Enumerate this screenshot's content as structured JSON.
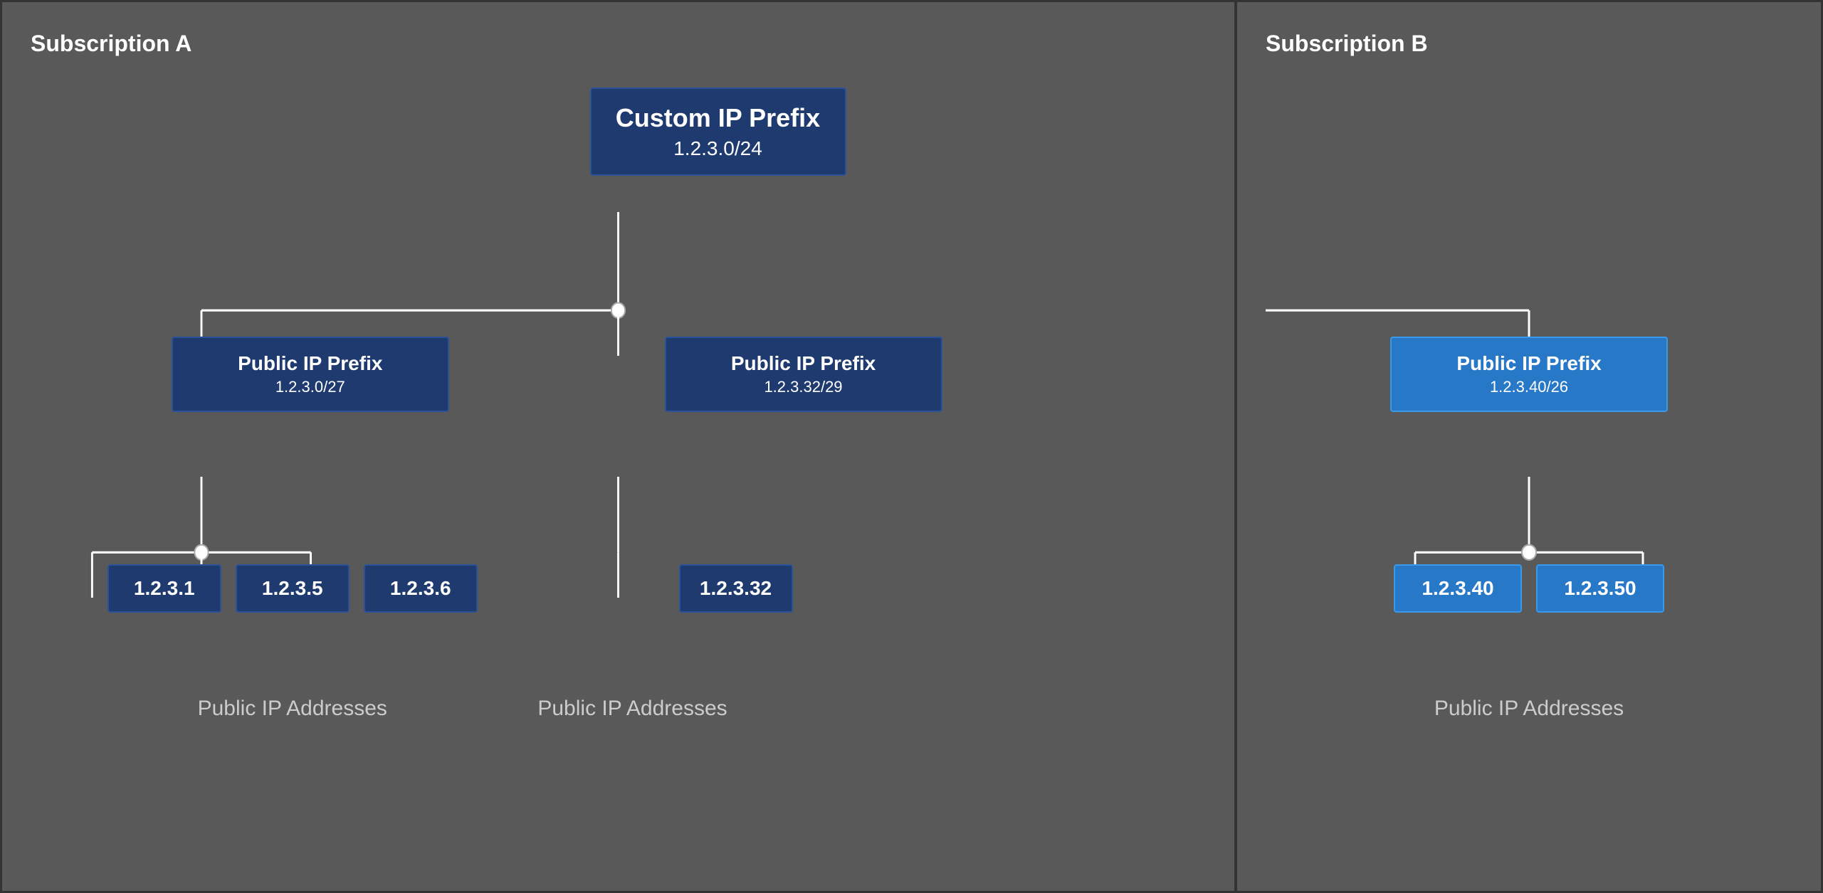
{
  "subscriptionA": {
    "label": "Subscription A",
    "customIPPrefix": {
      "title": "Custom IP Prefix",
      "subtitle": "1.2.3.0/24"
    },
    "prefixLeft": {
      "title": "Public IP Prefix",
      "subtitle": "1.2.3.0/27"
    },
    "prefixCenter": {
      "title": "Public IP Prefix",
      "subtitle": "1.2.3.32/29"
    },
    "ipsLeft": [
      "1.2.3.1",
      "1.2.3.5",
      "1.2.3.6"
    ],
    "ipCenter": "1.2.3.32",
    "labelLeft": "Public IP Addresses",
    "labelCenter": "Public IP Addresses"
  },
  "subscriptionB": {
    "label": "Subscription B",
    "prefixRight": {
      "title": "Public IP Prefix",
      "subtitle": "1.2.3.40/26"
    },
    "ipsRight": [
      "1.2.3.40",
      "1.2.3.50"
    ],
    "labelRight": "Public IP Addresses"
  }
}
